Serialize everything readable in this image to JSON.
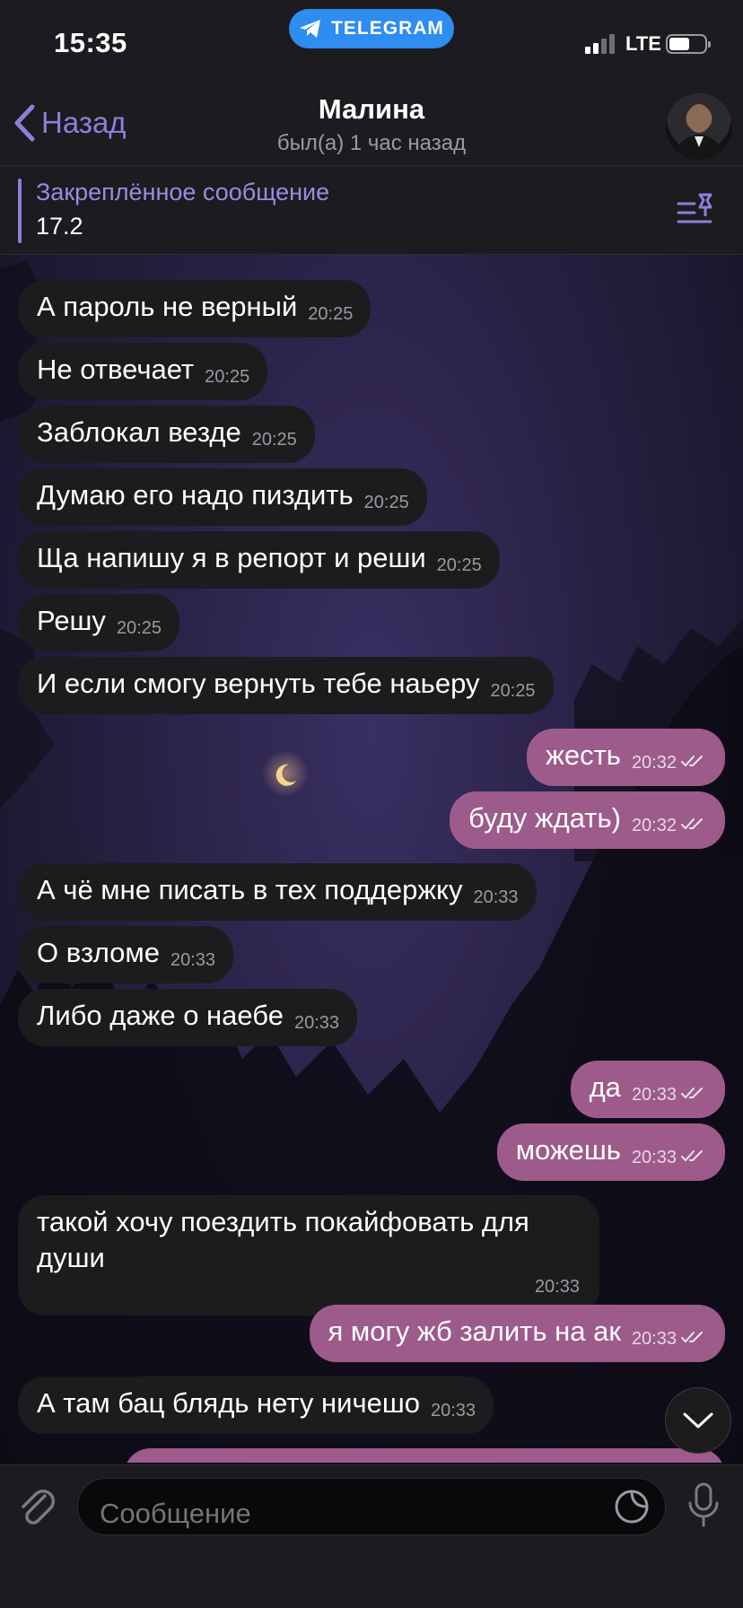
{
  "status_bar": {
    "time": "15:35",
    "app_pill": "TELEGRAM",
    "network": "LTE"
  },
  "header": {
    "back_label": "Назад",
    "chat_name": "Малина",
    "chat_status": "был(а) 1 час назад"
  },
  "pinned": {
    "title": "Закреплённое сообщение",
    "text": "17.2"
  },
  "messages": [
    {
      "dir": "in",
      "text": "А пароль не верный",
      "time": "20:25"
    },
    {
      "dir": "in",
      "text": "Не отвечает",
      "time": "20:25"
    },
    {
      "dir": "in",
      "text": "Заблокал везде",
      "time": "20:25"
    },
    {
      "dir": "in",
      "text": "Думаю его надо пиздить",
      "time": "20:25"
    },
    {
      "dir": "in",
      "text": "Ща напишу я в репорт и реши",
      "time": "20:25"
    },
    {
      "dir": "in",
      "text": "Решу",
      "time": "20:25"
    },
    {
      "dir": "in",
      "text": "И если смогу вернуть тебе наьеру",
      "time": "20:25"
    },
    {
      "dir": "out",
      "text": "жесть",
      "time": "20:32"
    },
    {
      "dir": "out",
      "text": "буду ждать)",
      "time": "20:32"
    },
    {
      "dir": "in",
      "text": "А чё мне писать в тех поддержку",
      "time": "20:33"
    },
    {
      "dir": "in",
      "text": "О взломе",
      "time": "20:33"
    },
    {
      "dir": "in",
      "text": "Либо даже о наебе",
      "time": "20:33"
    },
    {
      "dir": "out",
      "text": "да",
      "time": "20:33"
    },
    {
      "dir": "out",
      "text": "можешь",
      "time": "20:33"
    },
    {
      "dir": "in",
      "text": "такой хочу поездить покайфовать для души",
      "time": "20:33"
    },
    {
      "dir": "out",
      "text": "я могу жб залить на ак",
      "time": "20:33"
    },
    {
      "dir": "in",
      "text": "А там бац блядь нету ничешо",
      "time": "20:33"
    }
  ],
  "composer": {
    "placeholder": "Сообщение"
  },
  "colors": {
    "accent": "#8e7fd8",
    "outgoing_bubble": "#9d5b8b",
    "incoming_bubble": "#1c1c1e",
    "telegram_blue": "#2f8cf0"
  }
}
